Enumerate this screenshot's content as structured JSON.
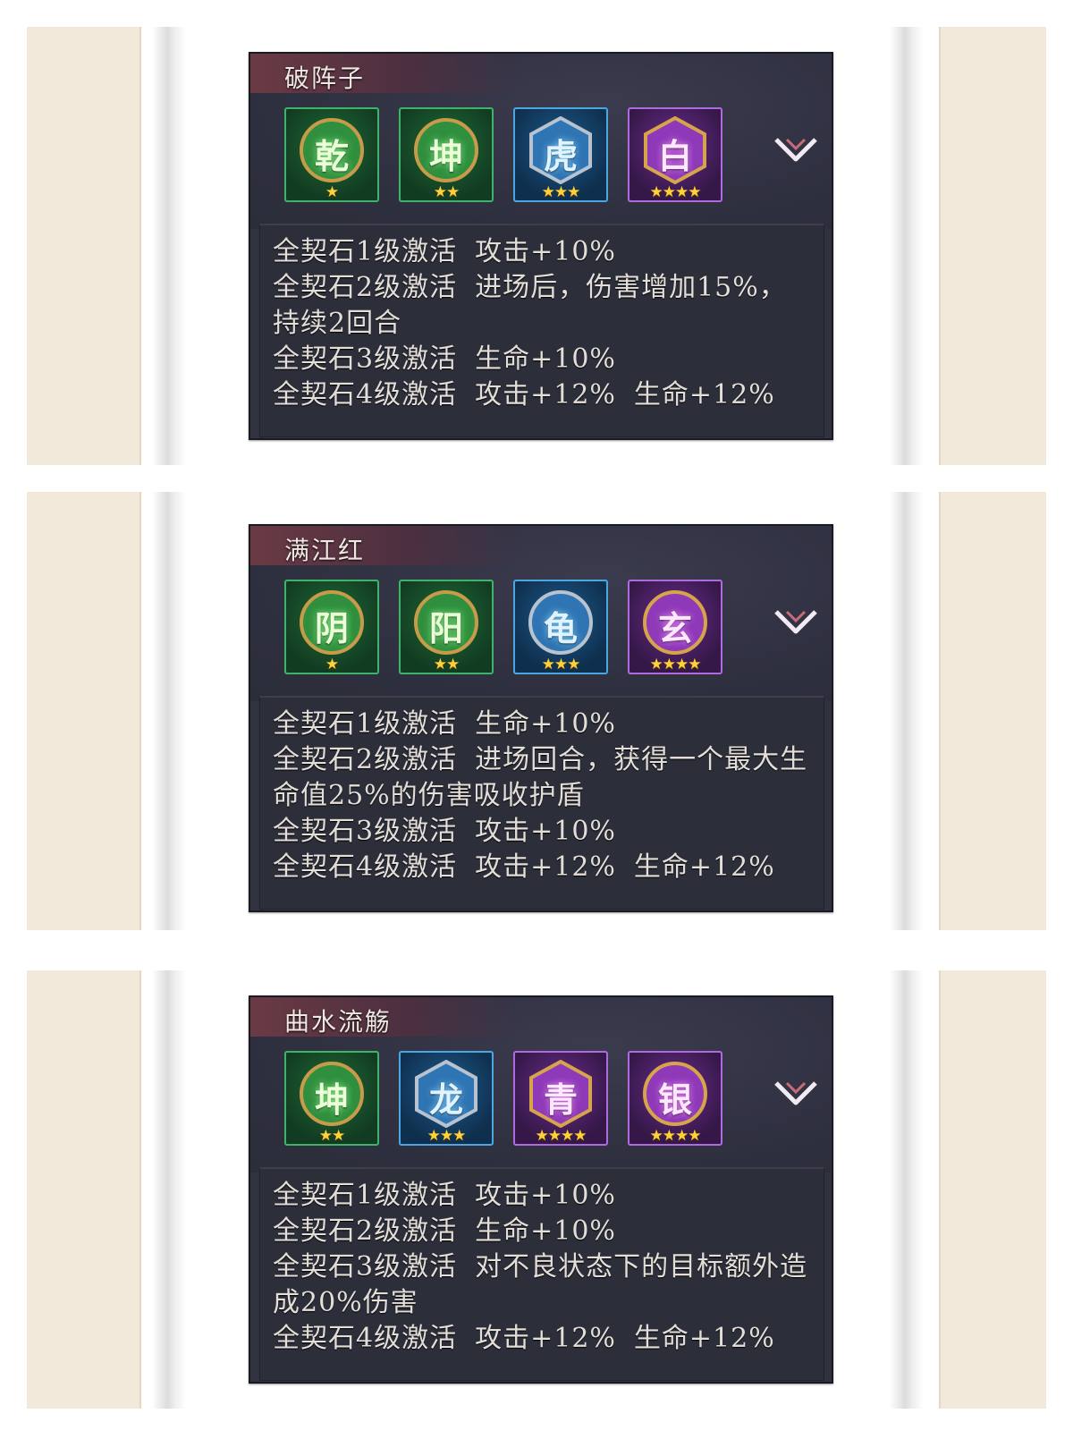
{
  "sets": [
    {
      "title": "破阵子",
      "stones": [
        {
          "glyph": "乾",
          "color": "green",
          "stars": "★"
        },
        {
          "glyph": "坤",
          "color": "green",
          "stars": "★★"
        },
        {
          "glyph": "虎",
          "color": "blue",
          "stars": "★★★"
        },
        {
          "glyph": "白",
          "color": "purple",
          "stars": "★★★★"
        }
      ],
      "effects": [
        {
          "level": "全契石1级激活",
          "text": "攻击+10%"
        },
        {
          "level": "全契石2级激活",
          "text": "进场后，伤害增加15%，持续2回合"
        },
        {
          "level": "全契石3级激活",
          "text": "生命+10%"
        },
        {
          "level": "全契石4级激活",
          "text": "攻击+12%",
          "text2": "生命+12%"
        }
      ]
    },
    {
      "title": "满江红",
      "stones": [
        {
          "glyph": "阴",
          "color": "green",
          "stars": "★"
        },
        {
          "glyph": "阳",
          "color": "green",
          "stars": "★★"
        },
        {
          "glyph": "龟",
          "color": "blue",
          "stars": "★★★"
        },
        {
          "glyph": "玄",
          "color": "purple",
          "stars": "★★★★"
        }
      ],
      "effects": [
        {
          "level": "全契石1级激活",
          "text": "生命+10%"
        },
        {
          "level": "全契石2级激活",
          "text": "进场回合，获得一个最大生命值25%的伤害吸收护盾"
        },
        {
          "level": "全契石3级激活",
          "text": "攻击+10%"
        },
        {
          "level": "全契石4级激活",
          "text": "攻击+12%",
          "text2": "生命+12%"
        }
      ]
    },
    {
      "title": "曲水流觞",
      "stones": [
        {
          "glyph": "坤",
          "color": "green",
          "stars": "★★"
        },
        {
          "glyph": "龙",
          "color": "blue",
          "stars": "★★★"
        },
        {
          "glyph": "青",
          "color": "purple",
          "stars": "★★★★"
        },
        {
          "glyph": "银",
          "color": "purple",
          "stars": "★★★★"
        }
      ],
      "effects": [
        {
          "level": "全契石1级激活",
          "text": "攻击+10%"
        },
        {
          "level": "全契石2级激活",
          "text": "生命+10%"
        },
        {
          "level": "全契石3级激活",
          "text": "对不良状态下的目标额外造成20%伤害"
        },
        {
          "level": "全契石4级激活",
          "text": "攻击+12%",
          "text2": "生命+12%"
        }
      ]
    }
  ]
}
